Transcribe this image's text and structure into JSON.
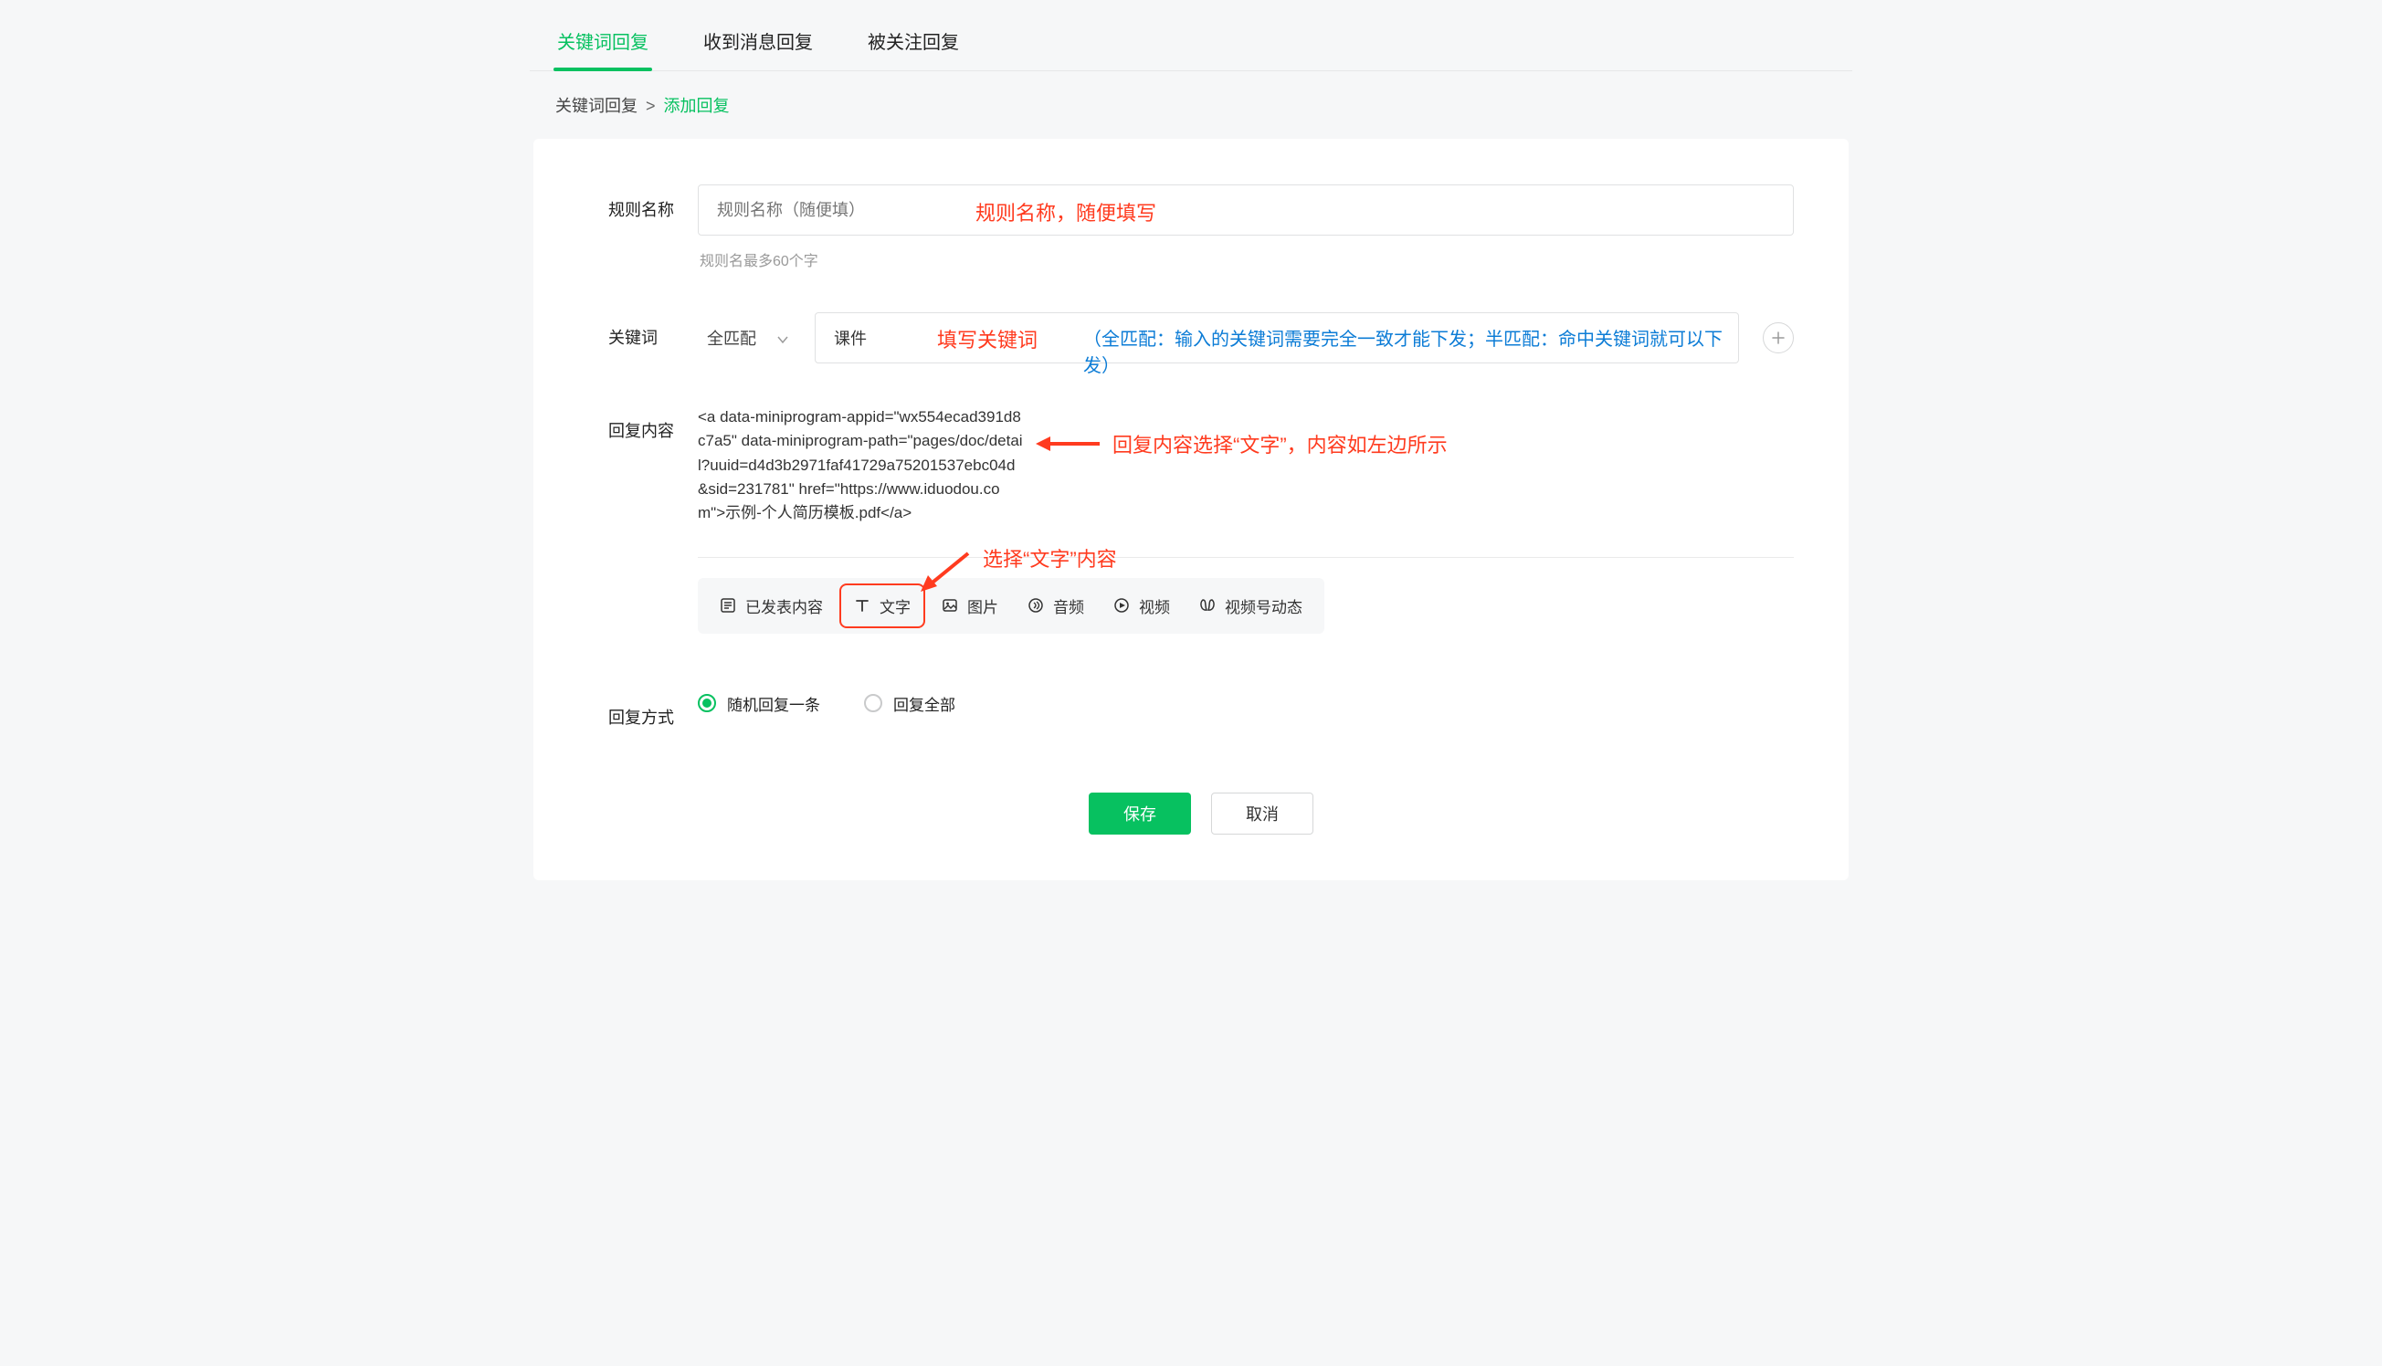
{
  "tabs": [
    {
      "label": "关键词回复",
      "active": true
    },
    {
      "label": "收到消息回复",
      "active": false
    },
    {
      "label": "被关注回复",
      "active": false
    }
  ],
  "breadcrumb": {
    "root": "关键词回复",
    "sep": ">",
    "current": "添加回复"
  },
  "form": {
    "ruleName": {
      "label": "规则名称",
      "placeholder": "规则名称（随便填）",
      "hint": "规则名最多60个字",
      "annotation": "规则名称，随便填写"
    },
    "keyword": {
      "label": "关键词",
      "matchMode": "全匹配",
      "value": "课件",
      "annotRed": "填写关键词",
      "annotBlue": "（全匹配：输入的关键词需要完全一致才能下发；半匹配：命中关键词就可以下发）"
    },
    "replyContent": {
      "label": "回复内容",
      "text": "<a data-miniprogram-appid=\"wx554ecad391d8c7a5\" data-miniprogram-path=\"pages/doc/detail?uuid=d4d3b2971faf41729a75201537ebc04d&sid=231781\" href=\"https://www.iduodou.com\">示例-个人简历模板.pdf</a>",
      "contentAnnotation": "回复内容选择“文字”，内容如左边所示",
      "typeAnnotation": "选择“文字”内容",
      "toolbar": [
        {
          "id": "published",
          "label": "已发表内容"
        },
        {
          "id": "text",
          "label": "文字",
          "selected": true
        },
        {
          "id": "image",
          "label": "图片"
        },
        {
          "id": "audio",
          "label": "音频"
        },
        {
          "id": "video",
          "label": "视频"
        },
        {
          "id": "channels",
          "label": "视频号动态"
        }
      ]
    },
    "replyMode": {
      "label": "回复方式",
      "options": [
        {
          "label": "随机回复一条",
          "selected": true
        },
        {
          "label": "回复全部",
          "selected": false
        }
      ]
    }
  },
  "actions": {
    "save": "保存",
    "cancel": "取消"
  }
}
